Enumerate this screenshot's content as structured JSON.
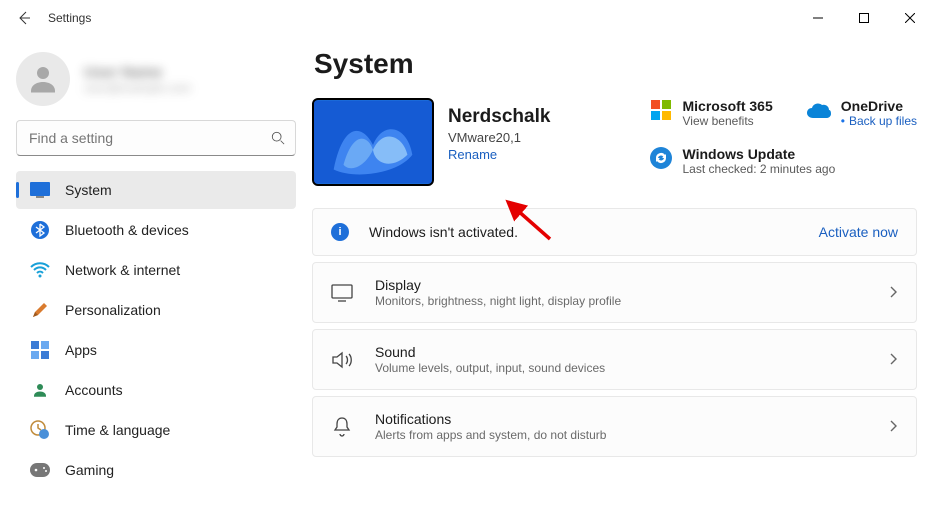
{
  "window": {
    "title": "Settings"
  },
  "account": {
    "name": "User Name",
    "email": "user@example.com"
  },
  "search": {
    "placeholder": "Find a setting"
  },
  "nav": [
    {
      "label": "System"
    },
    {
      "label": "Bluetooth & devices"
    },
    {
      "label": "Network & internet"
    },
    {
      "label": "Personalization"
    },
    {
      "label": "Apps"
    },
    {
      "label": "Accounts"
    },
    {
      "label": "Time & language"
    },
    {
      "label": "Gaming"
    }
  ],
  "page": {
    "heading": "System"
  },
  "pc": {
    "name": "Nerdschalk",
    "model": "VMware20,1",
    "rename": "Rename"
  },
  "tiles": {
    "m365": {
      "title": "Microsoft 365",
      "sub": "View benefits"
    },
    "onedrive": {
      "title": "OneDrive",
      "sub": "Back up files"
    },
    "wu": {
      "title": "Windows Update",
      "sub": "Last checked: 2 minutes ago"
    }
  },
  "activation": {
    "message": "Windows isn't activated.",
    "action": "Activate now"
  },
  "cards": [
    {
      "title": "Display",
      "sub": "Monitors, brightness, night light, display profile"
    },
    {
      "title": "Sound",
      "sub": "Volume levels, output, input, sound devices"
    },
    {
      "title": "Notifications",
      "sub": "Alerts from apps and system, do not disturb"
    }
  ]
}
